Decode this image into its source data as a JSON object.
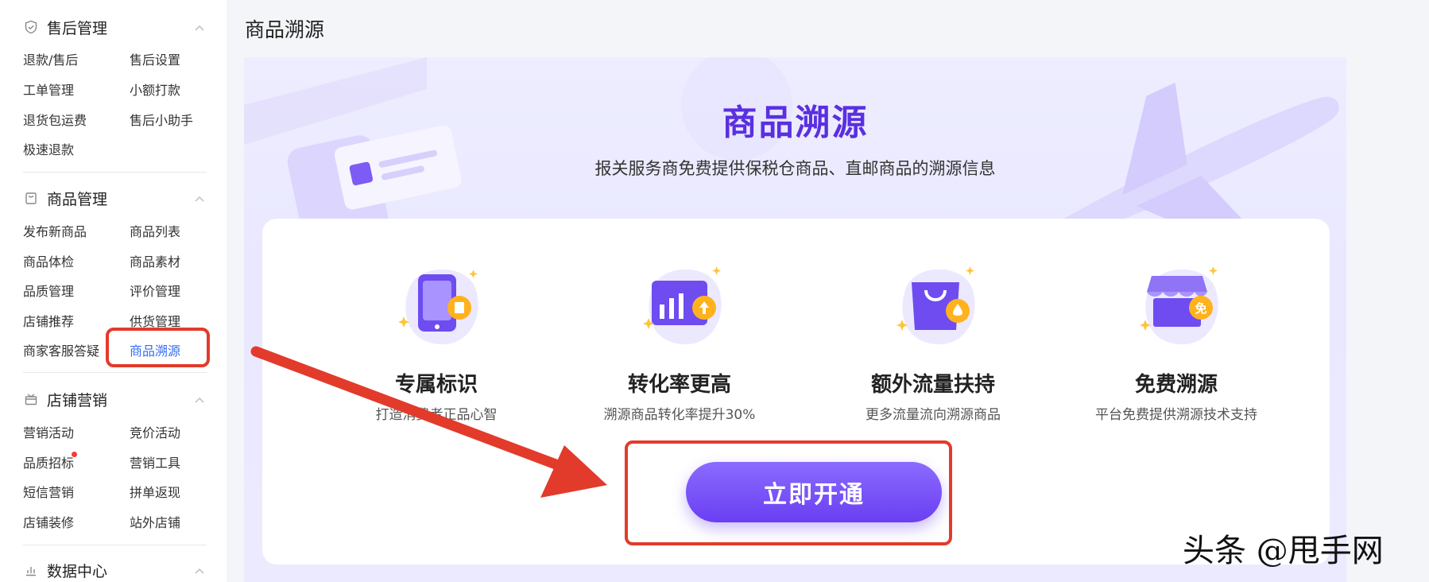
{
  "sidebar": {
    "sections": [
      {
        "title": "售后管理",
        "icon": "shield-check-icon",
        "items": [
          "退款/售后",
          "售后设置",
          "工单管理",
          "小额打款",
          "退货包运费",
          "售后小助手",
          "极速退款"
        ]
      },
      {
        "title": "商品管理",
        "icon": "bag-icon",
        "items": [
          "发布新商品",
          "商品列表",
          "商品体检",
          "商品素材",
          "品质管理",
          "评价管理",
          "店铺推荐",
          "供货管理",
          "商家客服答疑",
          "商品溯源"
        ],
        "active": "商品溯源"
      },
      {
        "title": "店铺营销",
        "icon": "gift-icon",
        "items": [
          "营销活动",
          "竞价活动",
          "品质招标",
          "营销工具",
          "短信营销",
          "拼单返现",
          "店铺装修",
          "站外店铺"
        ]
      },
      {
        "title": "数据中心",
        "icon": "bar-chart-icon",
        "items": []
      }
    ]
  },
  "main": {
    "page_title": "商品溯源",
    "banner": {
      "title": "商品溯源",
      "subtitle": "报关服务商免费提供保税仓商品、直邮商品的溯源信息"
    },
    "features": [
      {
        "name": "专属标识",
        "desc": "打造消费者正品心智",
        "icon": "tablet-badge-icon"
      },
      {
        "name": "转化率更高",
        "desc": "溯源商品转化率提升30%",
        "icon": "chart-up-icon"
      },
      {
        "name": "额外流量扶持",
        "desc": "更多流量流向溯源商品",
        "icon": "shopping-bag-drop-icon"
      },
      {
        "name": "免费溯源",
        "desc": "平台免费提供溯源技术支持",
        "icon": "store-free-icon"
      }
    ],
    "cta_label": "立即开通"
  },
  "watermark": "头条 @甩手网",
  "colors": {
    "accent": "#6a3ff2",
    "title_purple": "#5a2fe0",
    "active_link": "#2f6df6",
    "annotation_red": "#e23b2b"
  }
}
